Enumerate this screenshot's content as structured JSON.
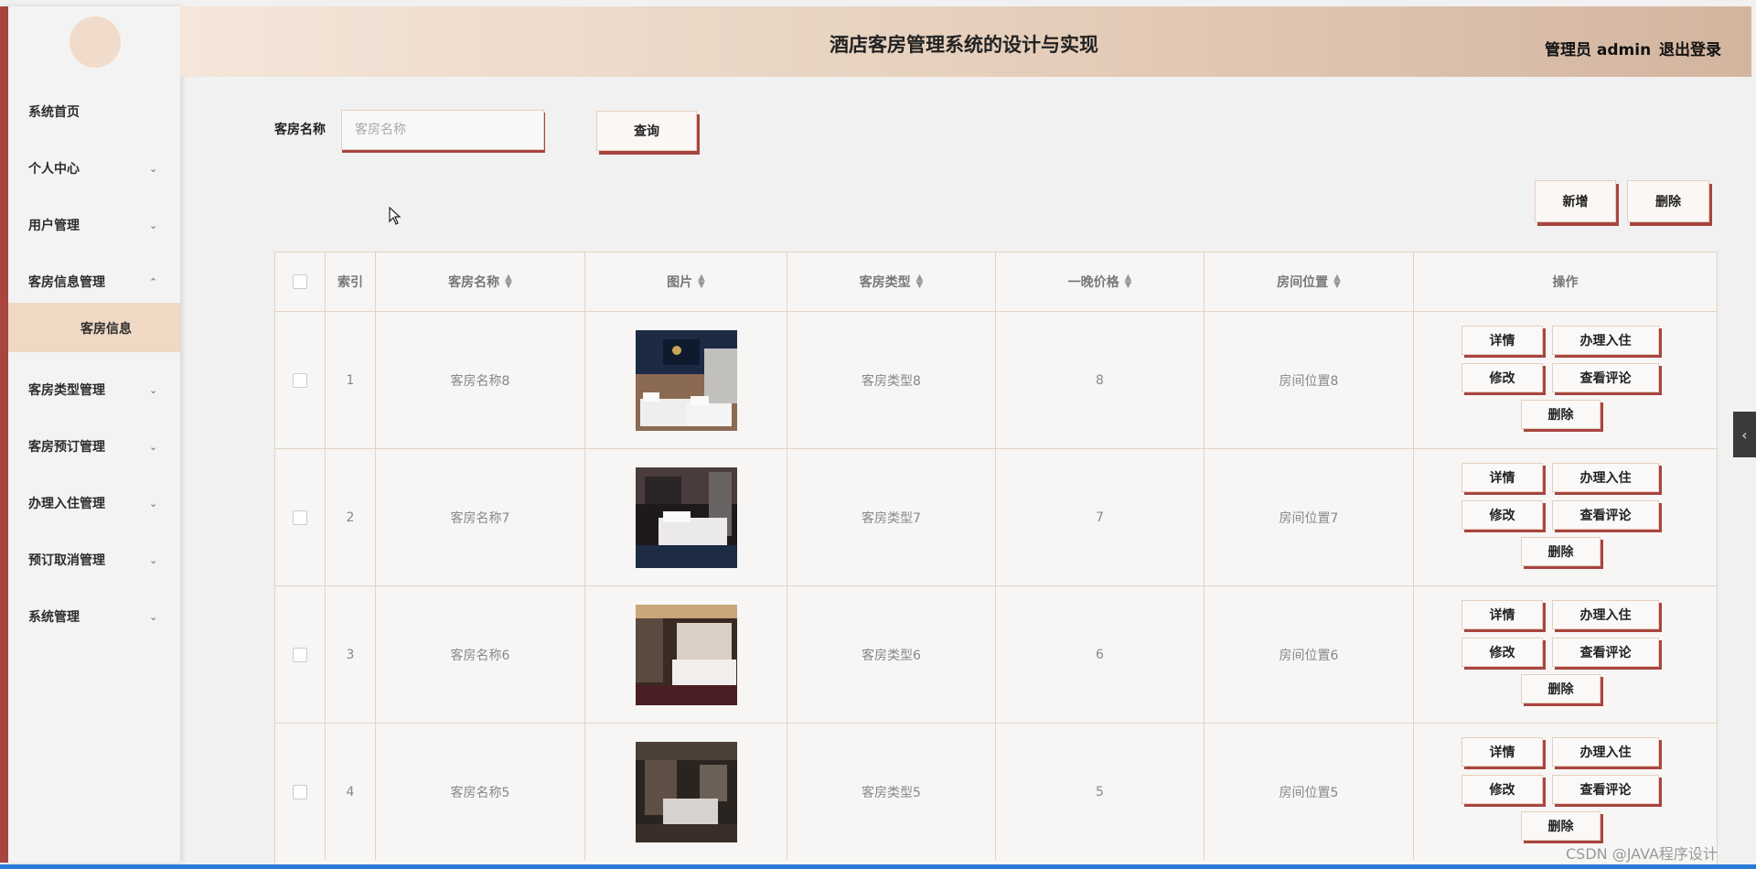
{
  "header": {
    "title": "酒店客房管理系统的设计与实现",
    "user": "管理员 admin",
    "logout": "退出登录"
  },
  "sidebar": {
    "items": [
      {
        "label": "系统首页"
      },
      {
        "label": "个人中心"
      },
      {
        "label": "用户管理"
      },
      {
        "label": "客房信息管理"
      },
      {
        "label": "客房类型管理"
      },
      {
        "label": "客房预订管理"
      },
      {
        "label": "办理入住管理"
      },
      {
        "label": "预订取消管理"
      },
      {
        "label": "系统管理"
      }
    ],
    "sub_item": "客房信息",
    "chevron_down": "⌄",
    "chevron_up": "⌃"
  },
  "search": {
    "label": "客房名称",
    "placeholder": "客房名称",
    "value": "",
    "button": "查询"
  },
  "toolbar": {
    "add": "新增",
    "delete": "删除"
  },
  "table": {
    "columns": [
      "索引",
      "客房名称",
      "图片",
      "客房类型",
      "一晚价格",
      "房间位置",
      "操作"
    ],
    "rows": [
      {
        "index": "1",
        "name": "客房名称8",
        "type": "客房类型8",
        "price": "8",
        "location": "房间位置8"
      },
      {
        "index": "2",
        "name": "客房名称7",
        "type": "客房类型7",
        "price": "7",
        "location": "房间位置7"
      },
      {
        "index": "3",
        "name": "客房名称6",
        "type": "客房类型6",
        "price": "6",
        "location": "房间位置6"
      },
      {
        "index": "4",
        "name": "客房名称5",
        "type": "客房类型5",
        "price": "5",
        "location": "房间位置5"
      }
    ],
    "actions": {
      "detail": "详情",
      "checkin": "办理入住",
      "edit": "修改",
      "comments": "查看评论",
      "delete": "删除"
    }
  },
  "side_toggle": "‹",
  "watermark": "CSDN @JAVA程序设计"
}
